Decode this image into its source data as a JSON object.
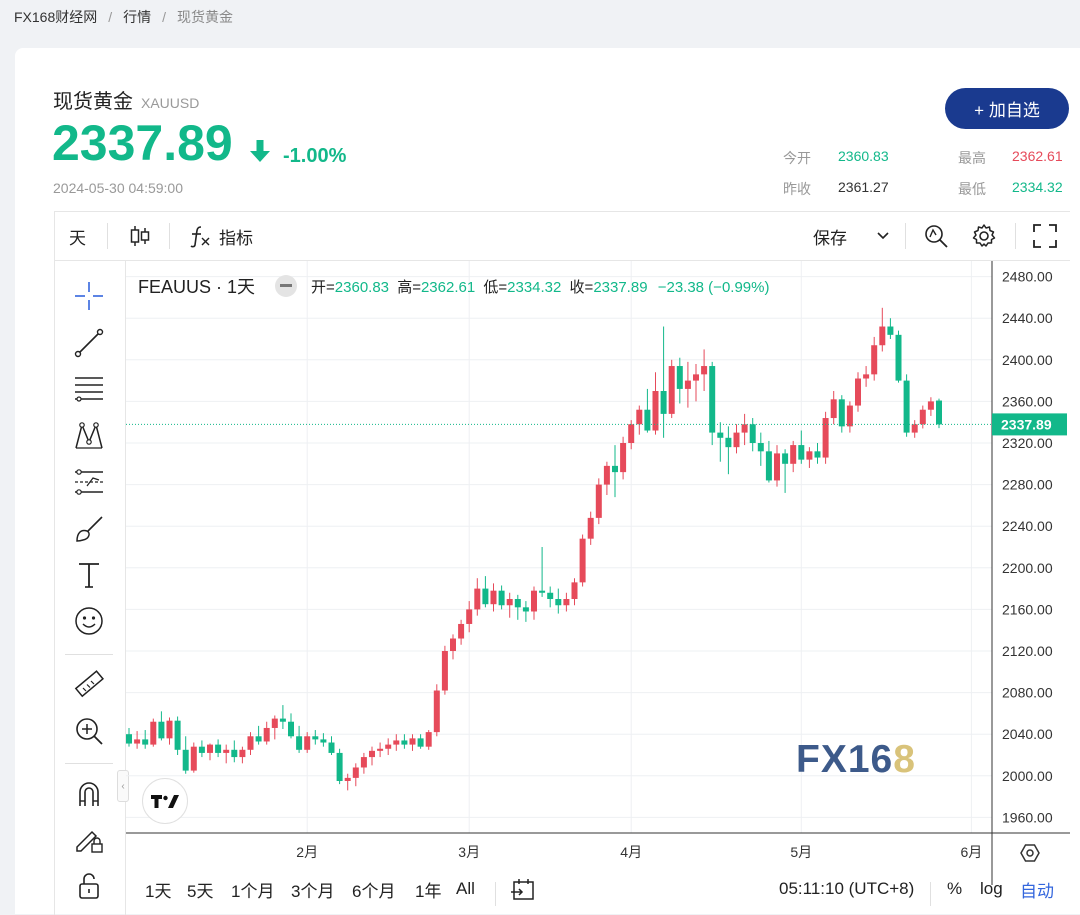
{
  "breadcrumb": {
    "home": "FX168财经网",
    "level2": "行情",
    "current": "现货黄金",
    "sep": "/"
  },
  "header": {
    "name": "现货黄金",
    "code": "XAUUSD",
    "price": "2337.89",
    "change_pct": "-1.00%",
    "timestamp": "2024-05-30 04:59:00",
    "add_button": "+ 加自选"
  },
  "stats": {
    "open_label": "今开",
    "open": "2360.83",
    "high_label": "最高",
    "high": "2362.61",
    "prev_label": "昨收",
    "prev": "2361.27",
    "low_label": "最低",
    "low": "2334.32"
  },
  "toolbar": {
    "interval": "天",
    "indicator_label": "指标",
    "save_label": "保存"
  },
  "legend": {
    "symbol": "FEAUUS · 1天",
    "open_k": "开=",
    "open": "2360.83",
    "high_k": "高=",
    "high": "2362.61",
    "low_k": "低=",
    "low": "2334.32",
    "close_k": "收=",
    "close": "2337.89",
    "change": "−23.38 (−0.99%)"
  },
  "ranges": [
    "1天",
    "5天",
    "1个月",
    "3个月",
    "6个月",
    "1年",
    "All"
  ],
  "bottom": {
    "time": "05:11:10 (UTC+8)",
    "pct": "%",
    "log": "log",
    "auto": "自动"
  },
  "watermark": {
    "fx": "FX16",
    "eight": "8"
  },
  "colors": {
    "up": "#e64a5a",
    "down": "#12b88a",
    "accent": "#1a3a8f"
  },
  "chart_data": {
    "type": "candlestick",
    "price_tag": "2337.89",
    "y_ticks": [
      "2480.00",
      "2440.00",
      "2400.00",
      "2360.00",
      "2320.00",
      "2280.00",
      "2240.00",
      "2200.00",
      "2160.00",
      "2120.00",
      "2080.00",
      "2040.00",
      "2000.00",
      "1960.00"
    ],
    "ylim": [
      1945,
      2495
    ],
    "x_ticks": [
      {
        "label": "2月",
        "i": 22
      },
      {
        "label": "3月",
        "i": 42
      },
      {
        "label": "4月",
        "i": 62
      },
      {
        "label": "5月",
        "i": 83
      },
      {
        "label": "6月",
        "i": 104
      }
    ],
    "series": [
      {
        "o": 2040,
        "h": 2046,
        "l": 2028,
        "c": 2031
      },
      {
        "o": 2031,
        "h": 2043,
        "l": 2026,
        "c": 2035
      },
      {
        "o": 2035,
        "h": 2044,
        "l": 2026,
        "c": 2030
      },
      {
        "o": 2030,
        "h": 2055,
        "l": 2028,
        "c": 2052
      },
      {
        "o": 2052,
        "h": 2062,
        "l": 2034,
        "c": 2036
      },
      {
        "o": 2036,
        "h": 2056,
        "l": 2030,
        "c": 2053
      },
      {
        "o": 2053,
        "h": 2057,
        "l": 2020,
        "c": 2025
      },
      {
        "o": 2025,
        "h": 2038,
        "l": 2002,
        "c": 2005
      },
      {
        "o": 2005,
        "h": 2032,
        "l": 2003,
        "c": 2028
      },
      {
        "o": 2028,
        "h": 2034,
        "l": 2018,
        "c": 2022
      },
      {
        "o": 2022,
        "h": 2031,
        "l": 2015,
        "c": 2030
      },
      {
        "o": 2030,
        "h": 2035,
        "l": 2018,
        "c": 2022
      },
      {
        "o": 2022,
        "h": 2030,
        "l": 2012,
        "c": 2025
      },
      {
        "o": 2025,
        "h": 2034,
        "l": 2013,
        "c": 2018
      },
      {
        "o": 2018,
        "h": 2028,
        "l": 2012,
        "c": 2025
      },
      {
        "o": 2025,
        "h": 2042,
        "l": 2020,
        "c": 2038
      },
      {
        "o": 2038,
        "h": 2048,
        "l": 2030,
        "c": 2033
      },
      {
        "o": 2033,
        "h": 2052,
        "l": 2030,
        "c": 2046
      },
      {
        "o": 2046,
        "h": 2058,
        "l": 2035,
        "c": 2055
      },
      {
        "o": 2055,
        "h": 2068,
        "l": 2045,
        "c": 2052
      },
      {
        "o": 2052,
        "h": 2060,
        "l": 2036,
        "c": 2038
      },
      {
        "o": 2038,
        "h": 2048,
        "l": 2022,
        "c": 2025
      },
      {
        "o": 2025,
        "h": 2042,
        "l": 2022,
        "c": 2038
      },
      {
        "o": 2038,
        "h": 2044,
        "l": 2030,
        "c": 2035
      },
      {
        "o": 2035,
        "h": 2041,
        "l": 2028,
        "c": 2032
      },
      {
        "o": 2032,
        "h": 2038,
        "l": 2020,
        "c": 2022
      },
      {
        "o": 2022,
        "h": 2026,
        "l": 1992,
        "c": 1995
      },
      {
        "o": 1995,
        "h": 2002,
        "l": 1986,
        "c": 1998
      },
      {
        "o": 1998,
        "h": 2012,
        "l": 1990,
        "c": 2008
      },
      {
        "o": 2008,
        "h": 2022,
        "l": 2002,
        "c": 2018
      },
      {
        "o": 2018,
        "h": 2028,
        "l": 2010,
        "c": 2024
      },
      {
        "o": 2024,
        "h": 2032,
        "l": 2018,
        "c": 2026
      },
      {
        "o": 2026,
        "h": 2036,
        "l": 2020,
        "c": 2030
      },
      {
        "o": 2030,
        "h": 2040,
        "l": 2024,
        "c": 2034
      },
      {
        "o": 2034,
        "h": 2040,
        "l": 2026,
        "c": 2030
      },
      {
        "o": 2030,
        "h": 2040,
        "l": 2024,
        "c": 2036
      },
      {
        "o": 2036,
        "h": 2040,
        "l": 2026,
        "c": 2028
      },
      {
        "o": 2028,
        "h": 2044,
        "l": 2025,
        "c": 2042
      },
      {
        "o": 2042,
        "h": 2088,
        "l": 2038,
        "c": 2082
      },
      {
        "o": 2082,
        "h": 2125,
        "l": 2078,
        "c": 2120
      },
      {
        "o": 2120,
        "h": 2136,
        "l": 2112,
        "c": 2132
      },
      {
        "o": 2132,
        "h": 2150,
        "l": 2126,
        "c": 2146
      },
      {
        "o": 2146,
        "h": 2168,
        "l": 2138,
        "c": 2160
      },
      {
        "o": 2160,
        "h": 2190,
        "l": 2154,
        "c": 2180
      },
      {
        "o": 2180,
        "h": 2192,
        "l": 2162,
        "c": 2165
      },
      {
        "o": 2165,
        "h": 2185,
        "l": 2158,
        "c": 2178
      },
      {
        "o": 2178,
        "h": 2183,
        "l": 2160,
        "c": 2164
      },
      {
        "o": 2164,
        "h": 2176,
        "l": 2152,
        "c": 2170
      },
      {
        "o": 2170,
        "h": 2174,
        "l": 2150,
        "c": 2162
      },
      {
        "o": 2162,
        "h": 2168,
        "l": 2148,
        "c": 2158
      },
      {
        "o": 2158,
        "h": 2182,
        "l": 2150,
        "c": 2178
      },
      {
        "o": 2178,
        "h": 2220,
        "l": 2172,
        "c": 2176
      },
      {
        "o": 2176,
        "h": 2182,
        "l": 2162,
        "c": 2170
      },
      {
        "o": 2170,
        "h": 2180,
        "l": 2156,
        "c": 2164
      },
      {
        "o": 2164,
        "h": 2176,
        "l": 2158,
        "c": 2170
      },
      {
        "o": 2170,
        "h": 2190,
        "l": 2164,
        "c": 2186
      },
      {
        "o": 2186,
        "h": 2232,
        "l": 2182,
        "c": 2228
      },
      {
        "o": 2228,
        "h": 2254,
        "l": 2222,
        "c": 2248
      },
      {
        "o": 2248,
        "h": 2286,
        "l": 2242,
        "c": 2280
      },
      {
        "o": 2280,
        "h": 2302,
        "l": 2270,
        "c": 2298
      },
      {
        "o": 2298,
        "h": 2318,
        "l": 2268,
        "c": 2292
      },
      {
        "o": 2292,
        "h": 2326,
        "l": 2285,
        "c": 2320
      },
      {
        "o": 2320,
        "h": 2342,
        "l": 2314,
        "c": 2338
      },
      {
        "o": 2338,
        "h": 2356,
        "l": 2328,
        "c": 2352
      },
      {
        "o": 2352,
        "h": 2372,
        "l": 2330,
        "c": 2332
      },
      {
        "o": 2332,
        "h": 2388,
        "l": 2328,
        "c": 2370
      },
      {
        "o": 2370,
        "h": 2432,
        "l": 2325,
        "c": 2348
      },
      {
        "o": 2348,
        "h": 2400,
        "l": 2344,
        "c": 2394
      },
      {
        "o": 2394,
        "h": 2402,
        "l": 2358,
        "c": 2372
      },
      {
        "o": 2372,
        "h": 2398,
        "l": 2354,
        "c": 2380
      },
      {
        "o": 2380,
        "h": 2396,
        "l": 2360,
        "c": 2386
      },
      {
        "o": 2386,
        "h": 2410,
        "l": 2370,
        "c": 2394
      },
      {
        "o": 2394,
        "h": 2398,
        "l": 2318,
        "c": 2330
      },
      {
        "o": 2330,
        "h": 2340,
        "l": 2302,
        "c": 2325
      },
      {
        "o": 2325,
        "h": 2336,
        "l": 2290,
        "c": 2316
      },
      {
        "o": 2316,
        "h": 2338,
        "l": 2310,
        "c": 2330
      },
      {
        "o": 2330,
        "h": 2348,
        "l": 2318,
        "c": 2338
      },
      {
        "o": 2338,
        "h": 2344,
        "l": 2312,
        "c": 2320
      },
      {
        "o": 2320,
        "h": 2330,
        "l": 2298,
        "c": 2312
      },
      {
        "o": 2312,
        "h": 2322,
        "l": 2282,
        "c": 2284
      },
      {
        "o": 2284,
        "h": 2318,
        "l": 2278,
        "c": 2310
      },
      {
        "o": 2310,
        "h": 2314,
        "l": 2272,
        "c": 2300
      },
      {
        "o": 2300,
        "h": 2322,
        "l": 2292,
        "c": 2318
      },
      {
        "o": 2318,
        "h": 2332,
        "l": 2300,
        "c": 2304
      },
      {
        "o": 2304,
        "h": 2316,
        "l": 2296,
        "c": 2312
      },
      {
        "o": 2312,
        "h": 2320,
        "l": 2300,
        "c": 2306
      },
      {
        "o": 2306,
        "h": 2350,
        "l": 2300,
        "c": 2344
      },
      {
        "o": 2344,
        "h": 2370,
        "l": 2338,
        "c": 2362
      },
      {
        "o": 2362,
        "h": 2366,
        "l": 2330,
        "c": 2336
      },
      {
        "o": 2336,
        "h": 2360,
        "l": 2330,
        "c": 2356
      },
      {
        "o": 2356,
        "h": 2388,
        "l": 2350,
        "c": 2382
      },
      {
        "o": 2382,
        "h": 2394,
        "l": 2374,
        "c": 2386
      },
      {
        "o": 2386,
        "h": 2422,
        "l": 2380,
        "c": 2414
      },
      {
        "o": 2414,
        "h": 2450,
        "l": 2408,
        "c": 2432
      },
      {
        "o": 2432,
        "h": 2440,
        "l": 2420,
        "c": 2424
      },
      {
        "o": 2424,
        "h": 2428,
        "l": 2378,
        "c": 2380
      },
      {
        "o": 2380,
        "h": 2386,
        "l": 2326,
        "c": 2330
      },
      {
        "o": 2330,
        "h": 2342,
        "l": 2325,
        "c": 2338
      },
      {
        "o": 2338,
        "h": 2356,
        "l": 2334,
        "c": 2352
      },
      {
        "o": 2352,
        "h": 2364,
        "l": 2346,
        "c": 2360
      },
      {
        "o": 2360.83,
        "h": 2362.61,
        "l": 2334.32,
        "c": 2337.89
      }
    ]
  }
}
